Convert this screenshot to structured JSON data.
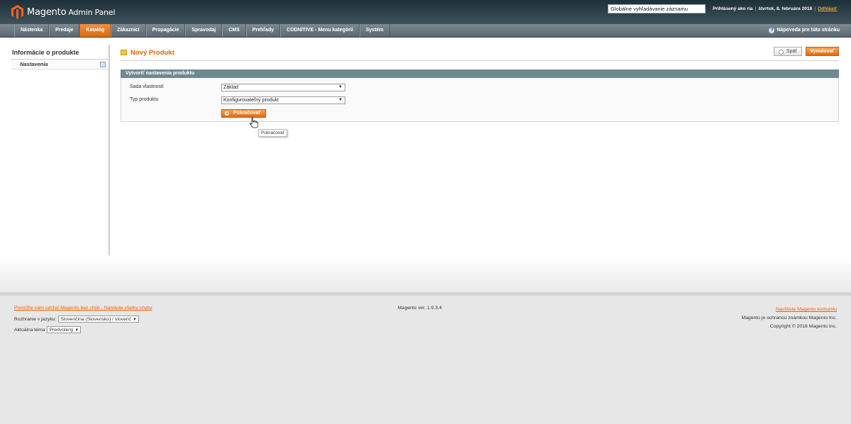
{
  "header": {
    "logo_brand": "Magento",
    "logo_suffix": "Admin Panel",
    "search_value": "Globálne vyhľadávanie záznamu",
    "logged_in": "Prihlásený ako ria",
    "date": "štvrtok, 8. februára 2018",
    "logout": "Odhlásiť"
  },
  "nav": {
    "items": [
      "Nástenka",
      "Predaje",
      "Katalóg",
      "Zákazníci",
      "Propagácie",
      "Spravodaj",
      "CMS",
      "Prehľady",
      "CODNITIVE - Menu kategórií",
      "Systém"
    ],
    "active": "Katalóg",
    "help": "Nápoveda pre túto stránku"
  },
  "sidebar": {
    "title": "Informácie o produkte",
    "items": [
      "Nastavenia"
    ]
  },
  "page": {
    "title": "Nový Produkt",
    "back_button": "Späť",
    "reset_button": "Vynulovať",
    "section_title": "Vytvoriť nastavenia produktu",
    "fields": [
      {
        "label": "Sada vlastností",
        "value": "Základ"
      },
      {
        "label": "Typ produktu",
        "value": "Konfigurovateľný produkt"
      }
    ],
    "continue_button": "Pokračovať",
    "tooltip": "Pokračovať"
  },
  "footer": {
    "bug_link": "Pomôžte nám udržať Magento bez chýb - Nahláste všetky chyby",
    "language_label": "Rozhranie v jazyku:",
    "language_value": "Slovenčina (Slovensko) / slovenč",
    "theme_label": "Aktuálna téma",
    "theme_value": "Predvolený",
    "version": "Magento ver. 1.9.3.4",
    "community_link": "Navštívte Magento komunitu",
    "trademark": "Magento je ochranou známkou Magento Inc.",
    "copyright": "Copyright © 2018 Magento Inc."
  },
  "colors": {
    "accent": "#eb5e00",
    "header_dark": "#1e2f38",
    "section_header": "#6f8992"
  }
}
